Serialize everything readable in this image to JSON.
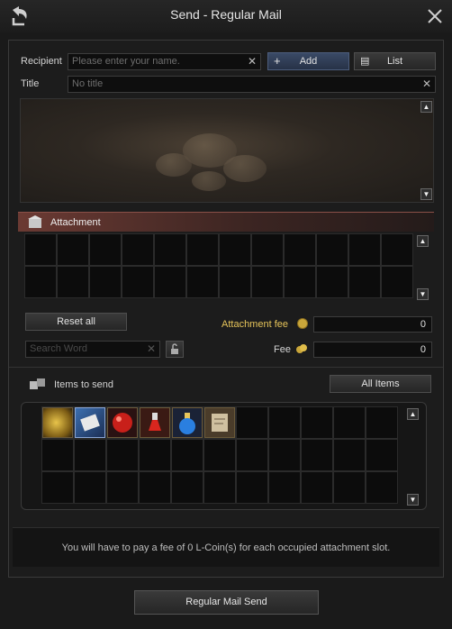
{
  "window": {
    "title": "Send - Regular Mail"
  },
  "recipient": {
    "label": "Recipient",
    "placeholder": "Please enter your name.",
    "add_label": "Add",
    "list_label": "List"
  },
  "title_field": {
    "label": "Title",
    "placeholder": "No title"
  },
  "attachment": {
    "header": "Attachment",
    "reset_label": "Reset all",
    "fee_label": "Attachment fee",
    "fee_value": "0"
  },
  "search": {
    "placeholder": "Search Word"
  },
  "fee": {
    "label": "Fee",
    "value": "0"
  },
  "items": {
    "header": "Items to send",
    "all_items_label": "All Items",
    "slots": [
      {
        "icon": "gold-coins-icon"
      },
      {
        "icon": "scroll-icon"
      },
      {
        "icon": "red-orb-icon"
      },
      {
        "icon": "red-potion-icon"
      },
      {
        "icon": "blue-potion-icon"
      },
      {
        "icon": "map-icon"
      }
    ]
  },
  "footer": {
    "note": "You will have to pay a fee of 0 L-Coin(s) for each occupied attachment slot."
  },
  "send": {
    "label": "Regular Mail Send"
  },
  "colors": {
    "accent_red": "#6b3a33",
    "gold": "#c9a63a",
    "panel_bg": "#1c1c1c"
  }
}
